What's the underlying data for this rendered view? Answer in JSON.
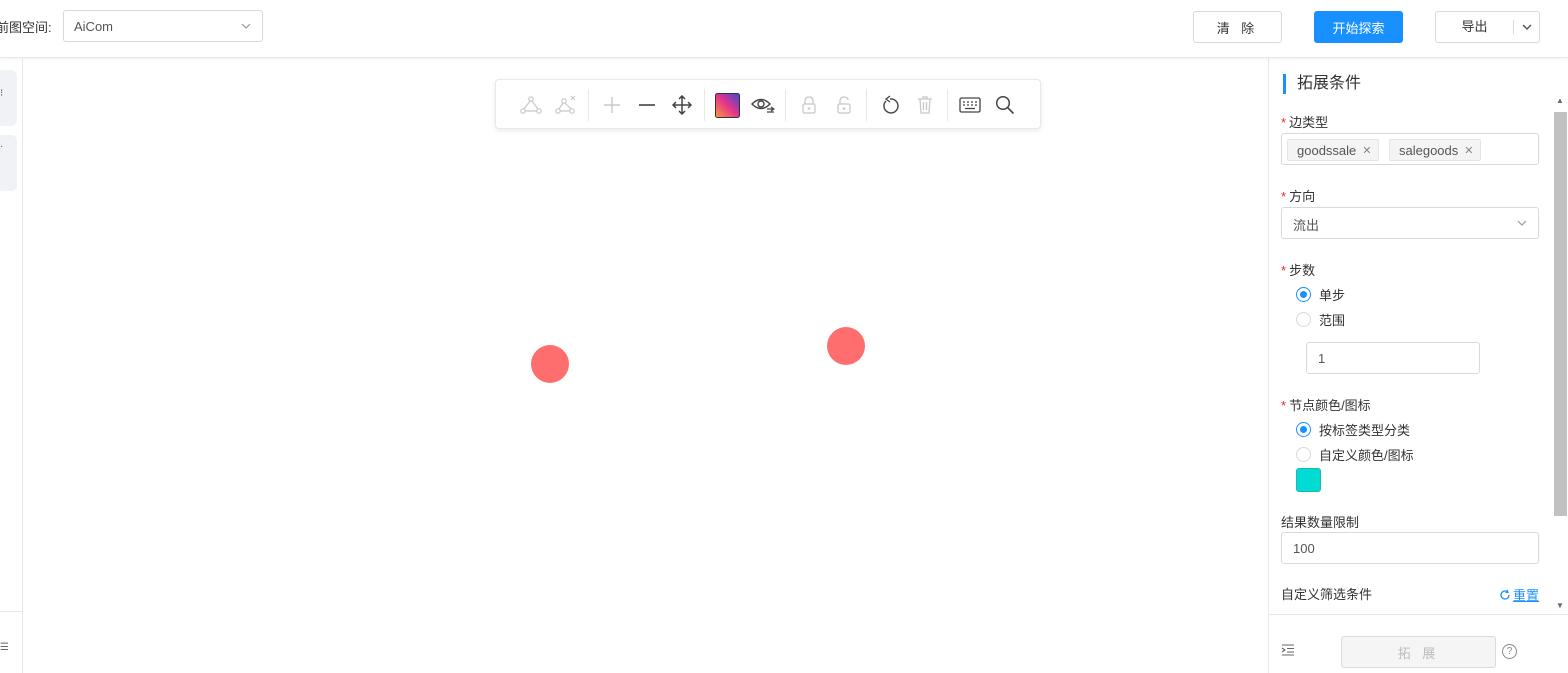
{
  "header": {
    "space_label": "前图空间:",
    "space_value": "AiCom",
    "clear_label": "清 除",
    "explore_label": "开始探索",
    "export_label": "导出"
  },
  "toolbar": {
    "tools": [
      "add-edge-icon",
      "remove-edge-icon",
      "zoom-in-icon",
      "zoom-out-icon",
      "fit-view-icon",
      "color-palette-icon",
      "toggle-visibility-icon",
      "lock-icon",
      "unlock-icon",
      "undo-icon",
      "delete-icon",
      "keyboard-icon",
      "search-icon"
    ]
  },
  "canvas": {
    "node_color": "#ff6e6e"
  },
  "panel": {
    "title": "拓展条件",
    "edge_type_label": "边类型",
    "edge_tags": [
      "goodssale",
      "salegoods"
    ],
    "direction_label": "方向",
    "direction_value": "流出",
    "steps_label": "步数",
    "step_single": "单步",
    "step_range": "范围",
    "step_value": "1",
    "node_color_label": "节点颜色/图标",
    "color_by_label": "按标签类型分类",
    "color_custom": "自定义颜色/图标",
    "swatch_color": "#00dcd4",
    "limit_label": "结果数量限制",
    "limit_value": "100",
    "filter_label": "自定义筛选条件",
    "reset_label": "重置",
    "expand_label": "拓 展",
    "help": "?"
  },
  "colors": {
    "accent": "#1890ff",
    "required": "#f5222d"
  }
}
